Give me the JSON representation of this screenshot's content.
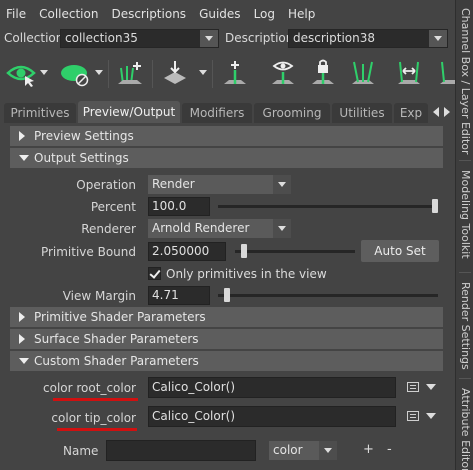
{
  "menu": [
    "File",
    "Collection",
    "Descriptions",
    "Guides",
    "Log",
    "Help"
  ],
  "collection": {
    "label": "Collection",
    "value": "collection35"
  },
  "description": {
    "label": "Description",
    "value": "description38"
  },
  "toolbar_icons": [
    "eye-cursor-icon",
    "green-shape-hidden-icon",
    "add-guide-icon",
    "place-guide-icon",
    "add-point-icon",
    "view-guide-icon",
    "lock-guide-icon",
    "select-guides-icon",
    "guide-tool-icon",
    "more-guides-icon"
  ],
  "tabs": [
    "Primitives",
    "Preview/Output",
    "Modifiers",
    "Grooming",
    "Utilities",
    "Exp"
  ],
  "active_tab": "Preview/Output",
  "sections": {
    "preview": "Preview Settings",
    "output": "Output Settings",
    "primitive_shader": "Primitive Shader Parameters",
    "surface_shader": "Surface Shader Parameters",
    "custom_shader": "Custom Shader Parameters"
  },
  "output": {
    "operation_label": "Operation",
    "operation_value": "Render",
    "percent_label": "Percent",
    "percent_value": "100.0",
    "percent_fraction": 1.0,
    "renderer_label": "Renderer",
    "renderer_value": "Arnold Renderer",
    "primitive_bound_label": "Primitive Bound",
    "primitive_bound_value": "2.050000",
    "primitive_bound_fraction": 0.05,
    "auto_set_label": "Auto Set",
    "only_primitives_label": "Only primitives in the view",
    "only_primitives_checked": true,
    "view_margin_label": "View Margin",
    "view_margin_value": "4.71",
    "view_margin_fraction": 0.03
  },
  "custom_shader": {
    "root_label": "color root_color",
    "root_value": "Calico_Color()",
    "tip_label": "color tip_color",
    "tip_value": "Calico_Color()",
    "name_label": "Name",
    "name_value": "",
    "type_value": "color",
    "add": "+",
    "remove": "-"
  },
  "side_tabs": [
    "Channel Box / Layer Editor",
    "Modeling Toolkit",
    "Render Settings",
    "Attribute Editor"
  ],
  "colors": {
    "accent_green": "#2fcf6a",
    "underline_red": "#d01010",
    "panel": "#444444"
  }
}
